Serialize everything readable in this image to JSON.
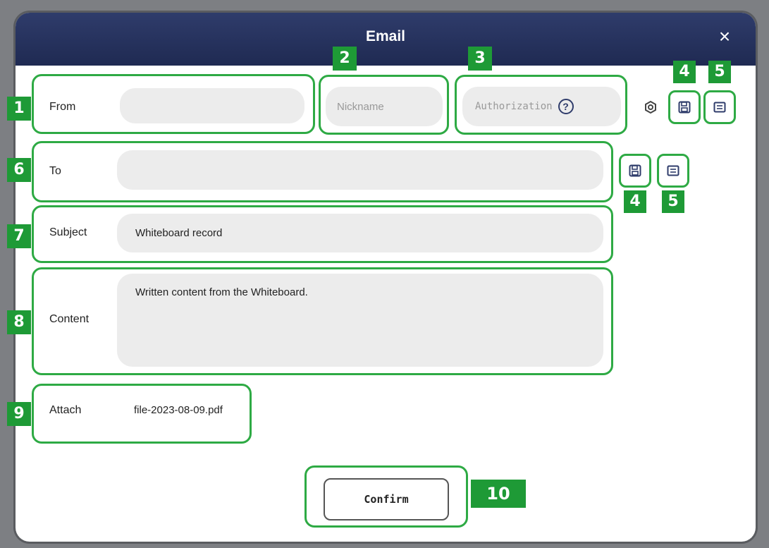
{
  "dialog": {
    "title": "Email",
    "close_glyph": "×"
  },
  "from": {
    "label": "From",
    "value": ""
  },
  "nickname": {
    "placeholder": "Nickname"
  },
  "authorization": {
    "placeholder": "Authorization",
    "help_glyph": "?"
  },
  "to": {
    "label": "To",
    "value": ""
  },
  "subject": {
    "label": "Subject",
    "value": "Whiteboard record"
  },
  "content": {
    "label": "Content",
    "value": "Written content from the Whiteboard."
  },
  "attach": {
    "label": "Attach",
    "filename": "file-2023-08-09.pdf"
  },
  "confirm": {
    "label": "Confirm"
  },
  "badges": {
    "from": "1",
    "nickname": "2",
    "authorization": "3",
    "save_top": "4",
    "list_top": "5",
    "to": "6",
    "save_to": "4",
    "list_to": "5",
    "subject": "7",
    "content": "8",
    "attach": "9",
    "confirm": "10"
  },
  "icons": {
    "settings": "settings-icon",
    "save": "save-icon",
    "contacts": "contact-list-icon",
    "help": "help-icon",
    "close": "close-icon"
  },
  "colors": {
    "titlebar": "#1f2a52",
    "highlight": "#2eaa44",
    "badge": "#1e9a36",
    "field_bg": "#ececec",
    "backdrop": "#7d7f83"
  }
}
